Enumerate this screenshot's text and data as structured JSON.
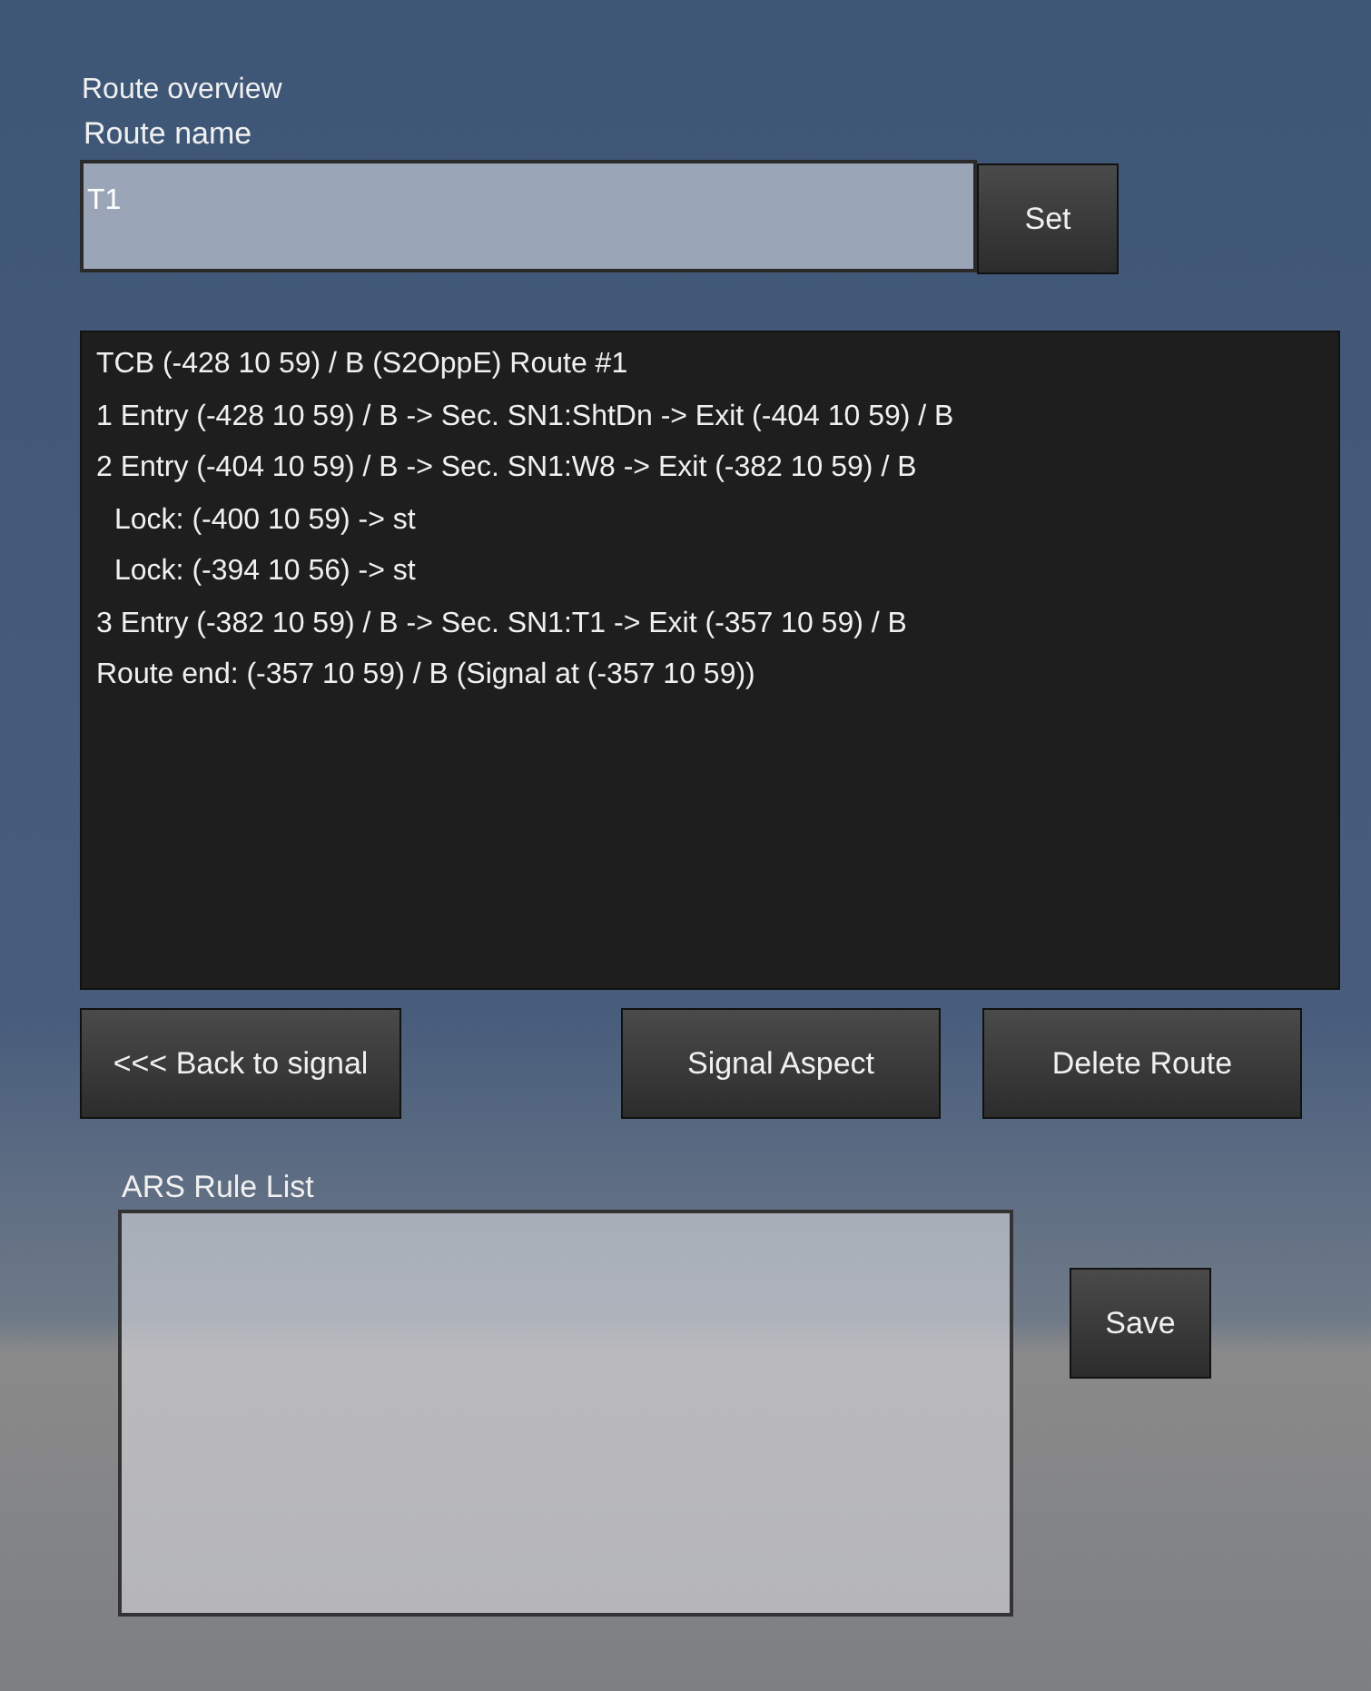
{
  "title": "Route overview",
  "route_name": {
    "label": "Route name",
    "value": "T1"
  },
  "set_button": "Set",
  "route_lines": [
    {
      "text": "TCB (-428 10 59) / B (S2OppE) Route #1"
    },
    {
      "text": "1 Entry (-428 10 59) / B -> Sec. SN1:ShtDn -> Exit (-404 10 59) / B"
    },
    {
      "text": "2 Entry (-404 10 59) / B -> Sec. SN1:W8 -> Exit (-382 10 59) / B",
      "children": [
        {
          "text": "Lock: (-400 10 59) -> st"
        },
        {
          "text": "Lock: (-394 10 56) -> st"
        }
      ]
    },
    {
      "text": "3 Entry (-382 10 59) / B -> Sec. SN1:T1 -> Exit (-357 10 59) / B"
    },
    {
      "text": "Route end: (-357 10 59) / B (Signal at (-357 10 59))"
    }
  ],
  "back_button": "<<< Back to signal",
  "signal_aspect_button": "Signal Aspect",
  "delete_route_button": "Delete Route",
  "ars_rule_list": {
    "label": "ARS Rule List"
  },
  "save_button": "Save"
}
